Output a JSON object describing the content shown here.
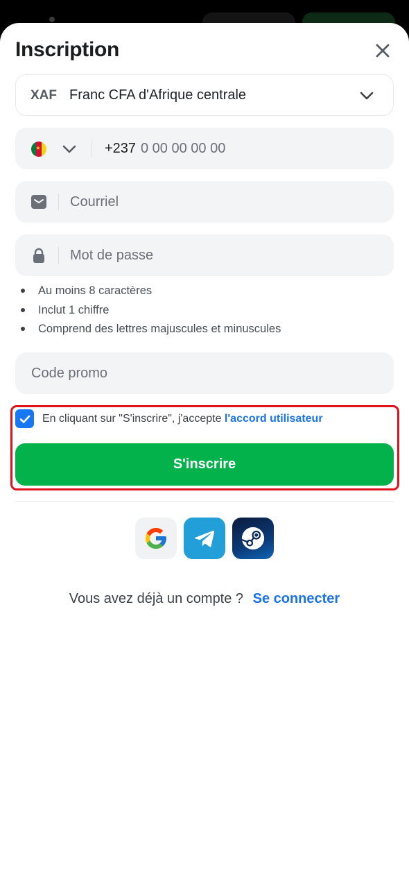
{
  "header": {
    "title": "Inscription"
  },
  "currency": {
    "code": "XAF",
    "name": "Franc CFA d'Afrique centrale"
  },
  "phone": {
    "prefix": "+237",
    "placeholder": "0 00 00 00 00"
  },
  "email": {
    "placeholder": "Courriel"
  },
  "password": {
    "placeholder": "Mot de passe",
    "rules": [
      "Au moins 8 caractères",
      "Inclut 1 chiffre",
      "Comprend des lettres majuscules et minuscules"
    ]
  },
  "promo": {
    "placeholder": "Code promo"
  },
  "agreement": {
    "checked": true,
    "text": "En cliquant sur \"S'inscrire\", j'accepte",
    "link": "l'accord utilisateur"
  },
  "submit": {
    "label": "S'inscrire"
  },
  "social": [
    "google-icon",
    "telegram-icon",
    "steam-icon"
  ],
  "login": {
    "prompt": "Vous avez déjà un compte ?",
    "link": "Se connecter"
  },
  "colors": {
    "accent": "#03b24b",
    "link": "#1a73e8",
    "highlight": "#e0121c"
  }
}
